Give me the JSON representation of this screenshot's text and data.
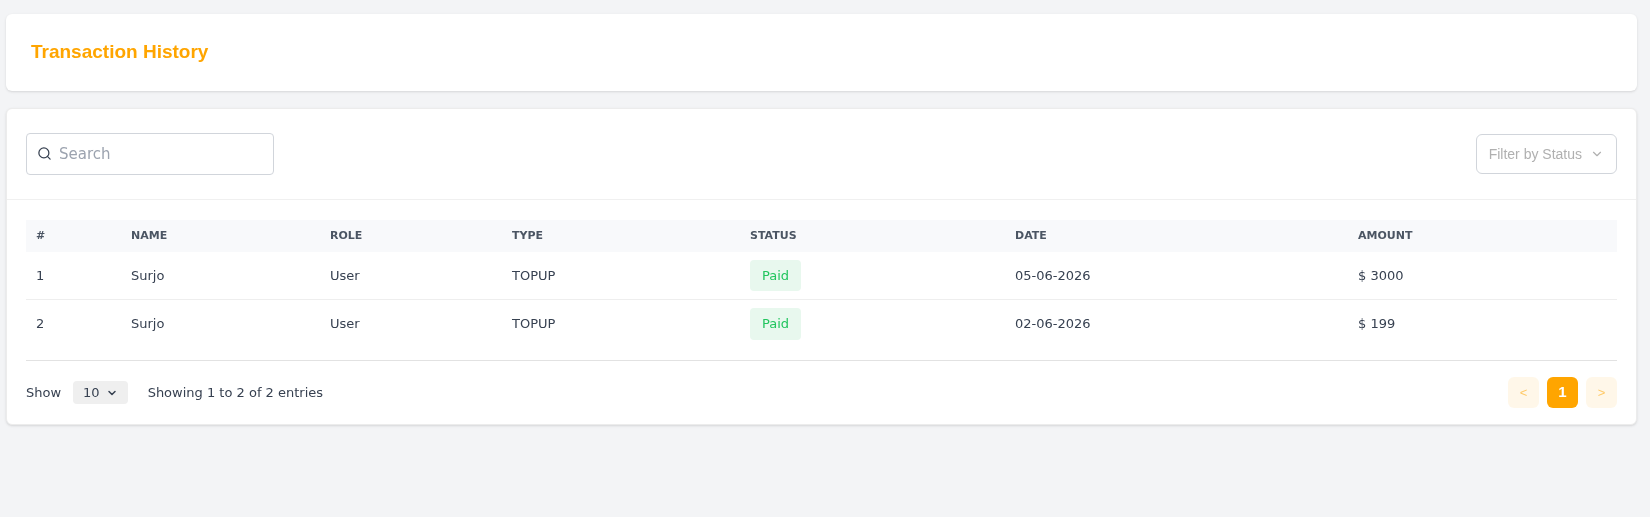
{
  "header": {
    "title": "Transaction History"
  },
  "toolbar": {
    "search": {
      "placeholder": "Search"
    },
    "filter": {
      "placeholder": "Filter by Status"
    }
  },
  "table": {
    "columns": [
      "#",
      "NAME",
      "ROLE",
      "TYPE",
      "STATUS",
      "DATE",
      "AMOUNT"
    ],
    "rows": [
      {
        "index": "1",
        "name": "Surjo",
        "role": "User",
        "type": "TOPUP",
        "status": {
          "text": "Paid",
          "kind": "paid"
        },
        "date": "05-06-2026",
        "amount": "$ 3000"
      },
      {
        "index": "2",
        "name": "Surjo",
        "role": "User",
        "type": "TOPUP",
        "status": {
          "text": "Paid",
          "kind": "paid"
        },
        "date": "02-06-2026",
        "amount": "$ 199"
      }
    ]
  },
  "footer": {
    "show_label": "Show",
    "page_size": "10",
    "summary": "Showing 1 to 2 of 2 entries",
    "pagination": [
      {
        "label": "<",
        "kind": "prev",
        "disabled": true,
        "selected": false
      },
      {
        "label": "1",
        "kind": "page",
        "disabled": false,
        "selected": true
      },
      {
        "label": ">",
        "kind": "next",
        "disabled": true,
        "selected": false
      }
    ]
  }
}
